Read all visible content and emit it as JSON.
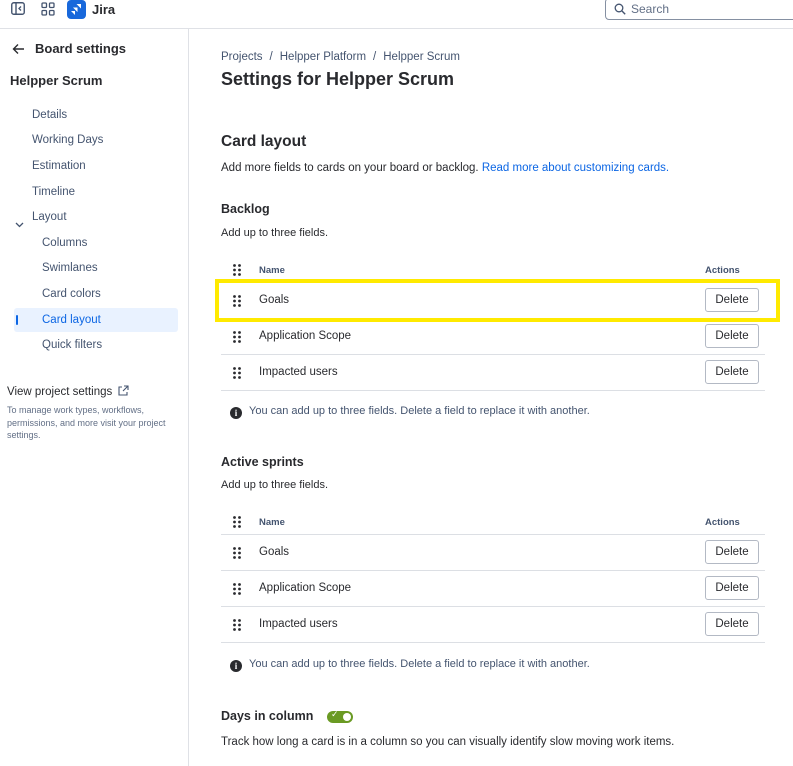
{
  "topbar": {
    "app_name": "Jira",
    "search_placeholder": "Search"
  },
  "sidebar": {
    "back_label": "Board settings",
    "board_name": "Helpper Scrum",
    "items": [
      {
        "label": "Details"
      },
      {
        "label": "Working Days"
      },
      {
        "label": "Estimation"
      },
      {
        "label": "Timeline"
      },
      {
        "label": "Layout"
      },
      {
        "label": "Columns"
      },
      {
        "label": "Swimlanes"
      },
      {
        "label": "Card colors"
      },
      {
        "label": "Card layout"
      },
      {
        "label": "Quick filters"
      }
    ],
    "active_item": "Card layout",
    "view_project": "View project settings",
    "view_project_desc": "To manage work types, workflows, permissions, and more visit your project settings."
  },
  "breadcrumb": [
    "Projects",
    "Helpper Platform",
    "Helpper Scrum"
  ],
  "page_title": "Settings for Helpper Scrum",
  "card_layout": {
    "title": "Card layout",
    "desc": "Add more fields to cards on your board or backlog.",
    "link": "Read more about customizing cards."
  },
  "table_headers": {
    "name": "Name",
    "actions": "Actions"
  },
  "delete_label": "Delete",
  "backlog": {
    "title": "Backlog",
    "desc": "Add up to three fields.",
    "rows": [
      {
        "name": "Goals"
      },
      {
        "name": "Application Scope"
      },
      {
        "name": "Impacted users"
      }
    ],
    "info": "You can add up to three fields. Delete a field to replace it with another."
  },
  "active_sprints": {
    "title": "Active sprints",
    "desc": "Add up to three fields.",
    "rows": [
      {
        "name": "Goals"
      },
      {
        "name": "Application Scope"
      },
      {
        "name": "Impacted users"
      }
    ],
    "info": "You can add up to three fields. Delete a field to replace it with another."
  },
  "days_in_column": {
    "title": "Days in column",
    "enabled": true,
    "desc": "Track how long a card is in a column so you can visually identify slow moving work items."
  },
  "colors": {
    "accent": "#0c66e4",
    "highlight": "#ffea00",
    "toggle_on": "#6a9a23"
  }
}
